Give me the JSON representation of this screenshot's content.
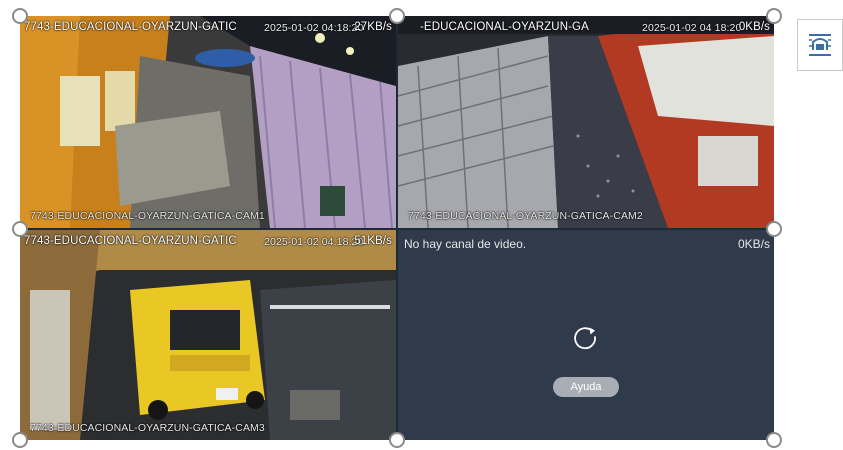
{
  "colors": {
    "empty_tile": "#2f3a4b",
    "grid_background": "#1d2a3a",
    "help_button": "#a9aeb6",
    "accent_icon": "#3a6ea5"
  },
  "cameras": [
    {
      "overlay_title": "7743-EDUCACIONAL-OYARZUN-GATIC",
      "timestamp": "2025-01-02 04:18:20",
      "bitrate": "27KB/s",
      "camera_label": "7743-EDUCACIONAL-OYARZUN-GATICA-CAM1"
    },
    {
      "overlay_title": "-EDUCACIONAL-OYARZUN-GA",
      "timestamp": "2025-01-02 04 18:20",
      "bitrate": "0KB/s",
      "camera_label": "7743-EDUCACIONAL-OYARZUN-GATICA-CAM2"
    },
    {
      "overlay_title": "7743-EDUCACIONAL-OYARZUN-GATIC",
      "timestamp": "2025-01-02 04:18:20",
      "bitrate": "51KB/s",
      "camera_label": "7743-EDUCACIONAL-OYARZUN-GATICA-CAM3"
    }
  ],
  "empty_channel": {
    "message": "No hay canal de video.",
    "bitrate": "0KB/s",
    "refresh_icon": "refresh-icon",
    "help_label": "Ayuda"
  },
  "toolbar": {
    "layout_icon": "image-layout-icon"
  }
}
